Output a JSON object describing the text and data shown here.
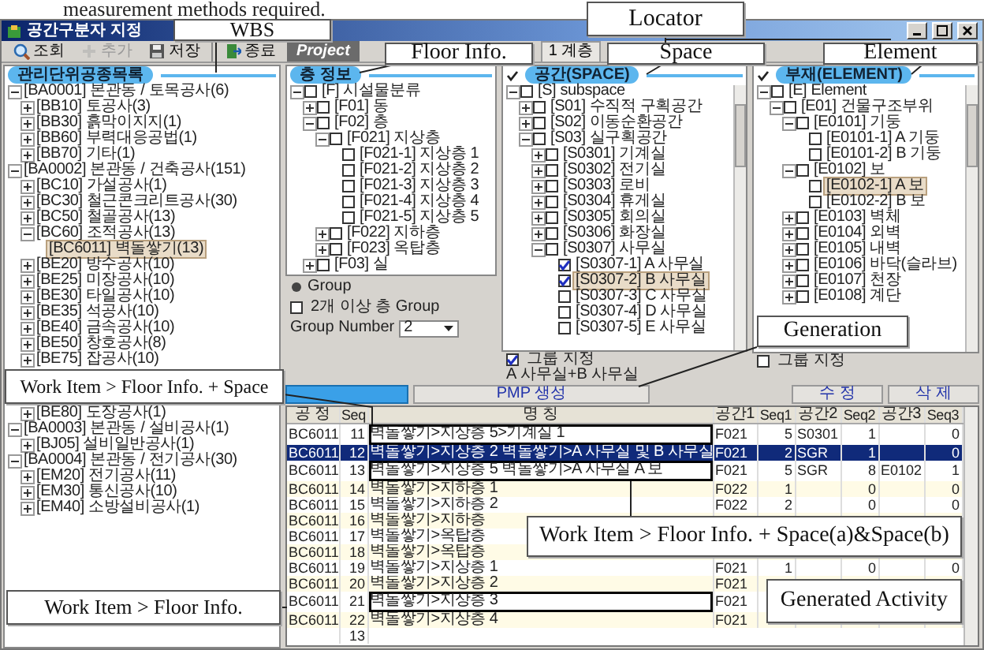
{
  "caption": "measurement methods required.",
  "window": {
    "title": "공간구분자 지정"
  },
  "toolbar": [
    {
      "kind": "search",
      "label": "조회",
      "disabled": false
    },
    {
      "kind": "add",
      "label": "추가",
      "disabled": true
    },
    {
      "kind": "save",
      "label": "저장",
      "disabled": false
    },
    {
      "kind": "exit",
      "label": "종료",
      "disabled": false
    },
    {
      "kind": "project",
      "label": "Project"
    },
    {
      "kind": "tab",
      "label": "1 계층"
    }
  ],
  "wbs_panel": {
    "title": "관리단위공종목록",
    "items": [
      {
        "label": "[BA0001] 본관동 / 토목공사(6)",
        "expanded": true,
        "selected": false,
        "children": [
          {
            "label": "[BB10] 토공사(3)",
            "expanded": false,
            "selected": false
          },
          {
            "label": "[BB30] 흙막이지지(1)",
            "expanded": false,
            "selected": false
          },
          {
            "label": "[BB60] 부력대응공법(1)",
            "expanded": false,
            "selected": false
          },
          {
            "label": "[BB70] 기타(1)",
            "expanded": false,
            "selected": false
          }
        ]
      },
      {
        "label": "[BA0002] 본관동 / 건축공사(151)",
        "expanded": true,
        "selected": false,
        "children": [
          {
            "label": "[BC10] 가설공사(1)",
            "expanded": false,
            "selected": false
          },
          {
            "label": "[BC30] 철근콘크리트공사(30)",
            "expanded": false,
            "selected": false
          },
          {
            "label": "[BC50] 철골공사(13)",
            "expanded": false,
            "selected": false
          },
          {
            "label": "[BC60] 조적공사(13)",
            "expanded": true,
            "selected": false,
            "children": [
              {
                "label": "[BC6011] 벽돌쌓기(13)",
                "selected": true
              }
            ]
          },
          {
            "label": "[BE20] 방수공사(10)",
            "expanded": false,
            "selected": false
          },
          {
            "label": "[BE25] 미장공사(10)",
            "expanded": false,
            "selected": false
          },
          {
            "label": "[BE30] 타일공사(10)",
            "expanded": false,
            "selected": false
          },
          {
            "label": "[BE35] 석공사(10)",
            "expanded": false,
            "selected": false
          },
          {
            "label": "[BE40] 금속공사(10)",
            "expanded": false,
            "selected": false
          },
          {
            "label": "[BE50] 창호공사(8)",
            "expanded": false,
            "selected": false
          },
          {
            "label": "[BE75] 잡공사(10)",
            "expanded": false,
            "selected": false
          },
          {
            "label": "[BE80] 도장공사(1)",
            "expanded": false,
            "selected": false
          }
        ]
      },
      {
        "label": "[BA0003] 본관동 / 설비공사(1)",
        "expanded": true,
        "selected": false,
        "children": [
          {
            "label": "[BJ05] 설비일반공사(1)",
            "expanded": false,
            "selected": false
          }
        ]
      },
      {
        "label": "[BA0004] 본관동 / 전기공사(30)",
        "expanded": true,
        "selected": false,
        "children": [
          {
            "label": "[EM20] 전기공사(11)",
            "expanded": false,
            "selected": false
          },
          {
            "label": "[EM30] 통신공사(10)",
            "expanded": false,
            "selected": false
          },
          {
            "label": "[EM40] 소방설비공사(1)",
            "expanded": false,
            "selected": false
          }
        ]
      }
    ]
  },
  "floor_panel": {
    "title": "층 정보",
    "items": [
      {
        "label": "[F] 시설물분류",
        "expanded": true,
        "checked": false,
        "selected": false,
        "children": [
          {
            "label": "[F01] 동",
            "expanded": false,
            "checked": false,
            "selected": false
          },
          {
            "label": "[F02] 층",
            "expanded": true,
            "checked": false,
            "selected": false,
            "children": [
              {
                "label": "[F021] 지상층",
                "expanded": true,
                "checked": false,
                "selected": false,
                "children": [
                  {
                    "label": "[F021-1] 지상층 1",
                    "checked": false,
                    "selected": false
                  },
                  {
                    "label": "[F021-2] 지상층 2",
                    "checked": false,
                    "selected": false
                  },
                  {
                    "label": "[F021-3] 지상층 3",
                    "checked": false,
                    "selected": false
                  },
                  {
                    "label": "[F021-4] 지상층 4",
                    "checked": false,
                    "selected": false
                  },
                  {
                    "label": "[F021-5] 지상층 5",
                    "checked": false,
                    "selected": false
                  }
                ]
              },
              {
                "label": "[F022] 지하층",
                "expanded": false,
                "checked": false,
                "selected": false
              },
              {
                "label": "[F023] 옥탑층",
                "expanded": false,
                "checked": false,
                "selected": false
              }
            ]
          },
          {
            "label": "[F03] 실",
            "expanded": false,
            "checked": false,
            "selected": false
          }
        ]
      }
    ],
    "group": {
      "label": "Group",
      "multi_floor": {
        "label": "2개 이상 층 Group",
        "checked": false
      },
      "number": {
        "label": "Group Number",
        "value": "2"
      }
    }
  },
  "space_panel": {
    "title": "공간(SPACE)",
    "checked": true,
    "items": [
      {
        "label": "[S] subspace",
        "expanded": true,
        "checked": false,
        "selected": false,
        "children": [
          {
            "label": "[S01] 수직적 구획공간",
            "expanded": false,
            "checked": false,
            "selected": false
          },
          {
            "label": "[S02] 이동순환공간",
            "expanded": false,
            "checked": false,
            "selected": false
          },
          {
            "label": "[S03] 실구획공간",
            "expanded": true,
            "checked": false,
            "selected": false,
            "children": [
              {
                "label": "[S0301] 기계실",
                "expanded": false,
                "checked": false,
                "selected": false
              },
              {
                "label": "[S0302] 전기실",
                "expanded": false,
                "checked": false,
                "selected": false
              },
              {
                "label": "[S0303] 로비",
                "expanded": false,
                "checked": false,
                "selected": false
              },
              {
                "label": "[S0304] 휴게실",
                "expanded": false,
                "checked": false,
                "selected": false
              },
              {
                "label": "[S0305] 회의실",
                "expanded": false,
                "checked": false,
                "selected": false
              },
              {
                "label": "[S0306] 화장실",
                "expanded": false,
                "checked": false,
                "selected": false
              },
              {
                "label": "[S0307] 사무실",
                "expanded": true,
                "checked": false,
                "selected": false,
                "children": [
                  {
                    "label": "[S0307-1] A 사무실",
                    "checked": true,
                    "selected": false
                  },
                  {
                    "label": "[S0307-2] B 사무실",
                    "checked": true,
                    "selected": true
                  },
                  {
                    "label": "[S0307-3] C 사무실",
                    "checked": false,
                    "selected": false
                  },
                  {
                    "label": "[S0307-4] D 사무실",
                    "checked": false,
                    "selected": false
                  },
                  {
                    "label": "[S0307-5] E 사무실",
                    "checked": false,
                    "selected": false
                  }
                ]
              }
            ]
          }
        ]
      }
    ],
    "group": {
      "label": "그룹 지정",
      "checked": true
    },
    "group_name": "A 사무실+B 사무실"
  },
  "element_panel": {
    "title": "부재(ELEMENT)",
    "checked": true,
    "items": [
      {
        "label": "[E] Element",
        "expanded": true,
        "checked": false,
        "selected": false,
        "children": [
          {
            "label": "[E01] 건물구조부위",
            "expanded": true,
            "checked": false,
            "selected": false,
            "children": [
              {
                "label": "[E0101] 기둥",
                "expanded": true,
                "checked": false,
                "selected": false,
                "children": [
                  {
                    "label": "[E0101-1] A 기둥",
                    "checked": false,
                    "selected": false
                  },
                  {
                    "label": "[E0101-2] B 기둥",
                    "checked": false,
                    "selected": false
                  }
                ]
              },
              {
                "label": "[E0102] 보",
                "expanded": true,
                "checked": false,
                "selected": false,
                "children": [
                  {
                    "label": "[E0102-1] A 보",
                    "checked": false,
                    "selected": true
                  },
                  {
                    "label": "[E0102-2] B 보",
                    "checked": false,
                    "selected": false
                  }
                ]
              },
              {
                "label": "[E0103] 벽체",
                "expanded": false,
                "checked": false,
                "selected": false
              },
              {
                "label": "[E0104] 외벽",
                "expanded": false,
                "checked": false,
                "selected": false
              },
              {
                "label": "[E0105] 내벽",
                "expanded": false,
                "checked": false,
                "selected": false
              },
              {
                "label": "[E0106] 바닥(슬라브)",
                "expanded": false,
                "checked": false,
                "selected": false
              },
              {
                "label": "[E0107] 천장",
                "expanded": false,
                "checked": false,
                "selected": false
              },
              {
                "label": "[E0108] 계단",
                "expanded": false,
                "checked": false,
                "selected": false
              }
            ]
          }
        ]
      }
    ],
    "group": {
      "label": "그룹 지정",
      "checked": false
    }
  },
  "actions": [
    {
      "kind": "primary"
    },
    {
      "kind": "default",
      "label": "PMP 생성"
    },
    {
      "kind": "default",
      "label": "수 정"
    },
    {
      "kind": "default",
      "label": "삭 제"
    }
  ],
  "grid": {
    "columns": [
      "공 정",
      "Seq",
      "명 칭",
      "공간1",
      "Seq1",
      "공간2",
      "Seq2",
      "공간3",
      "Seq3"
    ],
    "rows": [
      {
        "work": "BC6011",
        "seq": "11",
        "name": "벽돌쌓기>지상층 5>기계실 1",
        "space1": "F021",
        "seq1": "5",
        "space2": "S0301",
        "seq2": "1",
        "seq3": "0",
        "selected": false,
        "outlined": true
      },
      {
        "work": "BC6011",
        "seq": "12",
        "name": "벽돌쌓기>지상층 2 벽돌쌓기>A 사무실 및 B 사무실",
        "space1": "F021",
        "seq1": "2",
        "space2": "SGR",
        "seq2": "1",
        "seq3": "0",
        "selected": true,
        "outlined": false
      },
      {
        "work": "BC6011",
        "seq": "13",
        "name": "벽돌쌓기>지상층 5 벽돌쌓기>A 사무실 A 보",
        "space1": "F021",
        "seq1": "5",
        "space2": "SGR",
        "seq2": "8",
        "space3": "E0102",
        "seq3": "1",
        "selected": false,
        "outlined": true
      },
      {
        "work": "BC6011",
        "seq": "14",
        "name": "벽돌쌓기>지하층 1",
        "space1": "F022",
        "seq1": "1",
        "seq2": "0",
        "seq3": "0",
        "selected": false,
        "outlined": false
      },
      {
        "work": "BC6011",
        "seq": "15",
        "name": "벽돌쌓기>지하층 2",
        "space1": "F022",
        "seq1": "2",
        "seq2": "0",
        "seq3": "0",
        "selected": false,
        "outlined": false
      },
      {
        "work": "BC6011",
        "seq": "16",
        "name": "벽돌쌓기>지하층",
        "selected": false,
        "outlined": false
      },
      {
        "work": "BC6011",
        "seq": "17",
        "name": "벽돌쌓기>옥탑층",
        "selected": false,
        "outlined": false
      },
      {
        "work": "BC6011",
        "seq": "18",
        "name": "벽돌쌓기>옥탑층",
        "selected": false,
        "outlined": false
      },
      {
        "work": "BC6011",
        "seq": "19",
        "name": "벽돌쌓기>지상층 1",
        "space1": "F021",
        "seq1": "1",
        "seq2": "0",
        "seq3": "0",
        "selected": false,
        "outlined": false
      },
      {
        "work": "BC6011",
        "seq": "20",
        "name": "벽돌쌓기>지상층 2",
        "space1": "F021",
        "selected": false,
        "outlined": false
      },
      {
        "work": "BC6011",
        "seq": "21",
        "name": "벽돌쌓기>지상층 3",
        "space1": "F021",
        "selected": false,
        "outlined": true
      },
      {
        "work": "BC6011",
        "seq": "22",
        "name": "벽돌쌓기>지상층 4",
        "space1": "F021",
        "selected": false,
        "outlined": false
      }
    ],
    "footer": "13"
  },
  "annotations": [
    {
      "text": "Locator"
    },
    {
      "text": "WBS"
    },
    {
      "text": "Floor Info."
    },
    {
      "text": "Space"
    },
    {
      "text": "Element"
    },
    {
      "text": "Generation"
    },
    {
      "text": "Work Item > Floor Info. + Space"
    },
    {
      "text": "Work Item > Floor Info. + Space(a)&Space(b)"
    },
    {
      "text": "Work Item > Floor Info."
    },
    {
      "text": "Generated Activity"
    }
  ]
}
